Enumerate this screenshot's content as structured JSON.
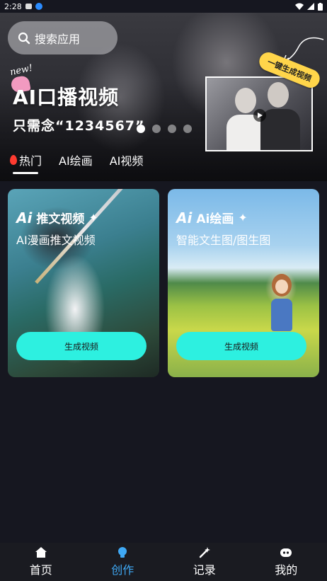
{
  "status_bar": {
    "time": "2:28"
  },
  "search": {
    "placeholder": "搜索应用"
  },
  "banner": {
    "badge": "new!",
    "title": "AI口播视频",
    "subtitle": "只需念“1234567”",
    "tag": "一键生成视频",
    "carousel": {
      "count": 4,
      "active_index": 0
    }
  },
  "tabs": [
    {
      "label": "热门",
      "active": true
    },
    {
      "label": "AI绘画",
      "active": false
    },
    {
      "label": "AI视频",
      "active": false
    }
  ],
  "cards": [
    {
      "logo": "Ai",
      "title": "推文视频",
      "subtitle": "AI漫画推文视频",
      "button": "生成视频"
    },
    {
      "logo": "Ai",
      "title": "Ai绘画",
      "subtitle": "智能文生图/图生图",
      "button": "生成视频"
    }
  ],
  "bottom_nav": [
    {
      "label": "首页",
      "icon": "home-icon",
      "active": false
    },
    {
      "label": "创作",
      "icon": "bulb-icon",
      "active": true
    },
    {
      "label": "记录",
      "icon": "magic-wand-icon",
      "active": false
    },
    {
      "label": "我的",
      "icon": "profile-icon",
      "active": false
    }
  ],
  "colors": {
    "accent": "#2df0e0",
    "nav_active": "#3fa9f5",
    "background": "#161720",
    "tag": "#ffd54a"
  }
}
